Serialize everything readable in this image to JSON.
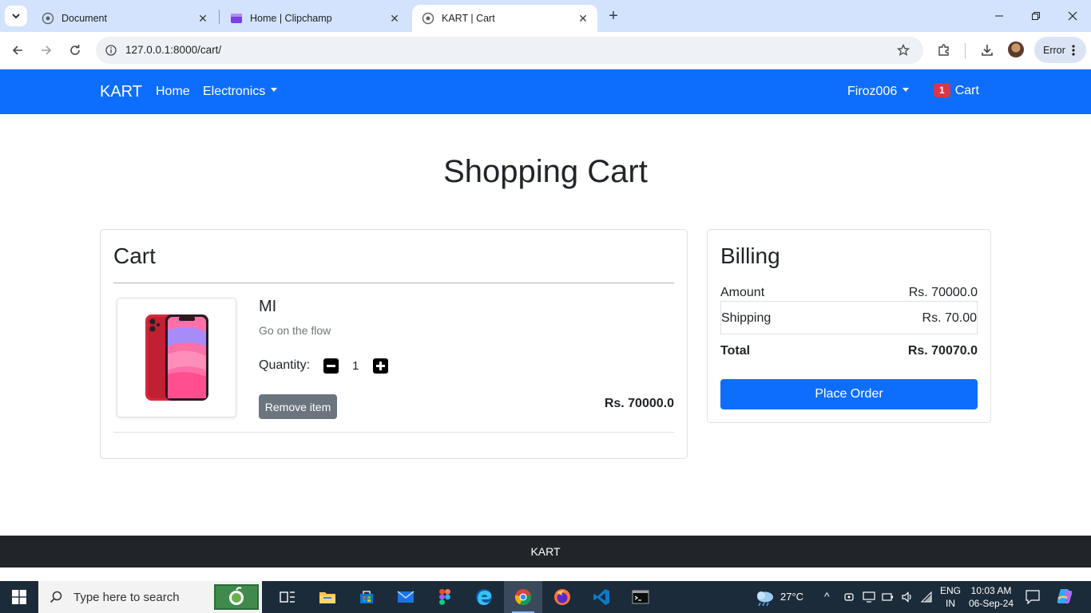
{
  "browser": {
    "tabs": [
      {
        "title": "Document"
      },
      {
        "title": "Home | Clipchamp"
      },
      {
        "title": "KART | Cart"
      }
    ],
    "url": "127.0.0.1:8000/cart/",
    "profile_status": "Error"
  },
  "navbar": {
    "brand": "KART",
    "links": [
      {
        "label": "Home"
      },
      {
        "label": "Electronics"
      }
    ],
    "user": "Firoz006",
    "cart_count": "1",
    "cart_label": "Cart",
    "color": "#0d6efd"
  },
  "page": {
    "title": "Shopping Cart"
  },
  "cart": {
    "heading": "Cart",
    "items": [
      {
        "name": "MI",
        "description": "Go on the flow",
        "quantity_label": "Quantity:",
        "quantity": "1",
        "remove_label": "Remove item",
        "price": "Rs. 70000.0"
      }
    ]
  },
  "billing": {
    "heading": "Billing",
    "rows": [
      {
        "label": "Amount",
        "value": "Rs. 70000.0"
      },
      {
        "label": "Shipping",
        "value": "Rs. 70.00"
      },
      {
        "label": "Total",
        "value": "Rs. 70070.0"
      }
    ],
    "place_order_label": "Place Order"
  },
  "footer": {
    "text": "KART"
  },
  "taskbar": {
    "search_placeholder": "Type here to search",
    "temperature": "27°C",
    "language": "ENG",
    "region": "IN",
    "time": "10:03 AM",
    "date": "06-Sep-24"
  }
}
